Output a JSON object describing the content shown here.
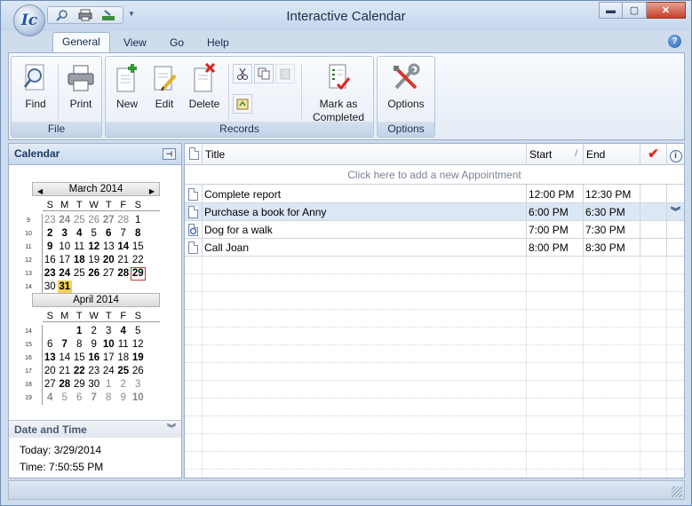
{
  "window": {
    "title": "Interactive Calendar",
    "logo_text": "Ic"
  },
  "tabs": [
    {
      "label": "General",
      "active": true
    },
    {
      "label": "View"
    },
    {
      "label": "Go"
    },
    {
      "label": "Help"
    }
  ],
  "ribbon": {
    "groups": {
      "file": "File",
      "records": "Records",
      "options": "Options"
    },
    "buttons": {
      "find": "Find",
      "print": "Print",
      "new": "New",
      "edit": "Edit",
      "delete": "Delete",
      "mark_line1": "Mark as",
      "mark_line2": "Completed",
      "options": "Options"
    }
  },
  "calendar": {
    "header": "Calendar",
    "dow": [
      "S",
      "M",
      "T",
      "W",
      "T",
      "F",
      "S"
    ],
    "months": [
      {
        "title": "March 2014",
        "weeks": [
          {
            "wk": "9",
            "days": [
              {
                "d": "23",
                "s": "g"
              },
              {
                "d": "24",
                "s": "gb"
              },
              {
                "d": "25",
                "s": "g"
              },
              {
                "d": "26",
                "s": "g"
              },
              {
                "d": "27",
                "s": "gb"
              },
              {
                "d": "28",
                "s": "g"
              },
              {
                "d": "1",
                "s": ""
              }
            ]
          },
          {
            "wk": "10",
            "days": [
              {
                "d": "2",
                "s": "b"
              },
              {
                "d": "3",
                "s": "b"
              },
              {
                "d": "4",
                "s": "b"
              },
              {
                "d": "5",
                "s": ""
              },
              {
                "d": "6",
                "s": "b"
              },
              {
                "d": "7",
                "s": ""
              },
              {
                "d": "8",
                "s": "b"
              }
            ]
          },
          {
            "wk": "11",
            "days": [
              {
                "d": "9",
                "s": "b"
              },
              {
                "d": "10",
                "s": ""
              },
              {
                "d": "11",
                "s": ""
              },
              {
                "d": "12",
                "s": "b"
              },
              {
                "d": "13",
                "s": ""
              },
              {
                "d": "14",
                "s": "b"
              },
              {
                "d": "15",
                "s": ""
              }
            ]
          },
          {
            "wk": "12",
            "days": [
              {
                "d": "16",
                "s": ""
              },
              {
                "d": "17",
                "s": ""
              },
              {
                "d": "18",
                "s": "b"
              },
              {
                "d": "19",
                "s": ""
              },
              {
                "d": "20",
                "s": "b"
              },
              {
                "d": "21",
                "s": ""
              },
              {
                "d": "22",
                "s": ""
              }
            ]
          },
          {
            "wk": "13",
            "days": [
              {
                "d": "23",
                "s": "b"
              },
              {
                "d": "24",
                "s": "b"
              },
              {
                "d": "25",
                "s": ""
              },
              {
                "d": "26",
                "s": "b"
              },
              {
                "d": "27",
                "s": ""
              },
              {
                "d": "28",
                "s": "b"
              },
              {
                "d": "29",
                "s": "sel"
              }
            ]
          },
          {
            "wk": "14",
            "days": [
              {
                "d": "30",
                "s": ""
              },
              {
                "d": "31",
                "s": "today"
              }
            ]
          }
        ]
      },
      {
        "title": "April 2014",
        "weeks": [
          {
            "wk": "14",
            "days": [
              {
                "d": "",
                "s": ""
              },
              {
                "d": "",
                "s": ""
              },
              {
                "d": "1",
                "s": "b"
              },
              {
                "d": "2",
                "s": ""
              },
              {
                "d": "3",
                "s": ""
              },
              {
                "d": "4",
                "s": "b"
              },
              {
                "d": "5",
                "s": ""
              }
            ]
          },
          {
            "wk": "15",
            "days": [
              {
                "d": "6",
                "s": ""
              },
              {
                "d": "7",
                "s": "b"
              },
              {
                "d": "8",
                "s": ""
              },
              {
                "d": "9",
                "s": ""
              },
              {
                "d": "10",
                "s": "b"
              },
              {
                "d": "11",
                "s": ""
              },
              {
                "d": "12",
                "s": ""
              }
            ]
          },
          {
            "wk": "16",
            "days": [
              {
                "d": "13",
                "s": "b"
              },
              {
                "d": "14",
                "s": ""
              },
              {
                "d": "15",
                "s": ""
              },
              {
                "d": "16",
                "s": "b"
              },
              {
                "d": "17",
                "s": ""
              },
              {
                "d": "18",
                "s": ""
              },
              {
                "d": "19",
                "s": "b"
              }
            ]
          },
          {
            "wk": "17",
            "days": [
              {
                "d": "20",
                "s": ""
              },
              {
                "d": "21",
                "s": ""
              },
              {
                "d": "22",
                "s": "b"
              },
              {
                "d": "23",
                "s": ""
              },
              {
                "d": "24",
                "s": ""
              },
              {
                "d": "25",
                "s": "b"
              },
              {
                "d": "26",
                "s": ""
              }
            ]
          },
          {
            "wk": "18",
            "days": [
              {
                "d": "27",
                "s": ""
              },
              {
                "d": "28",
                "s": "b"
              },
              {
                "d": "29",
                "s": ""
              },
              {
                "d": "30",
                "s": ""
              },
              {
                "d": "1",
                "s": "g"
              },
              {
                "d": "2",
                "s": "g"
              },
              {
                "d": "3",
                "s": "g"
              }
            ]
          },
          {
            "wk": "19",
            "days": [
              {
                "d": "4",
                "s": "gb"
              },
              {
                "d": "5",
                "s": "g"
              },
              {
                "d": "6",
                "s": "g"
              },
              {
                "d": "7",
                "s": "gb"
              },
              {
                "d": "8",
                "s": "g"
              },
              {
                "d": "9",
                "s": "g"
              },
              {
                "d": "10",
                "s": "gb"
              }
            ]
          }
        ]
      }
    ]
  },
  "datetime": {
    "header": "Date and Time",
    "today": "Today: 3/29/2014",
    "time": "Time: 7:50:55 PM"
  },
  "appointments": {
    "columns": {
      "title": "Title",
      "start": "Start",
      "end": "End"
    },
    "add_hint": "Click here to add a new Appointment",
    "rows": [
      {
        "title": "Complete report",
        "start": "12:00 PM",
        "end": "12:30 PM"
      },
      {
        "title": "Purchase a book for Anny",
        "start": "6:00 PM",
        "end": "6:30 PM",
        "selected": true
      },
      {
        "title": "Dog for a walk",
        "start": "7:00 PM",
        "end": "7:30 PM",
        "recurring": true
      },
      {
        "title": "Call Joan",
        "start": "8:00 PM",
        "end": "8:30 PM"
      }
    ]
  },
  "colors": {
    "accent": "#1f56a8",
    "check": "#d9261c",
    "selected_row": "#dbe7f5",
    "today": "#f5cf57"
  }
}
